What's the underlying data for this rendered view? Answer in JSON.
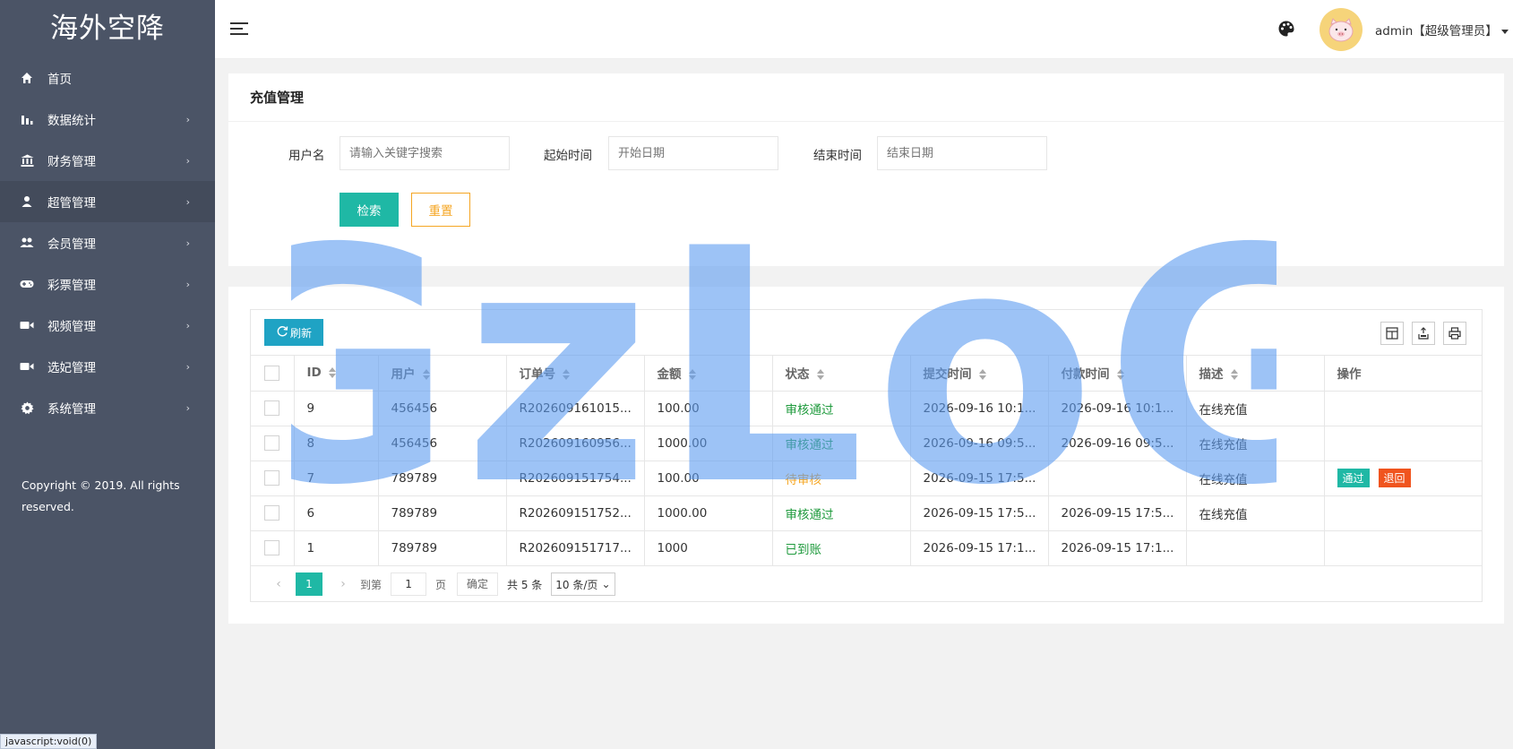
{
  "sidebar": {
    "logo": "海外空降",
    "items": [
      {
        "label": "首页",
        "icon": "home-icon",
        "has_arrow": false
      },
      {
        "label": "数据统计",
        "icon": "bar-chart-icon",
        "has_arrow": true
      },
      {
        "label": "财务管理",
        "icon": "bank-icon",
        "has_arrow": true
      },
      {
        "label": "超管管理",
        "icon": "user-icon",
        "has_arrow": true
      },
      {
        "label": "会员管理",
        "icon": "users-icon",
        "has_arrow": true
      },
      {
        "label": "彩票管理",
        "icon": "gamepad-icon",
        "has_arrow": true
      },
      {
        "label": "视频管理",
        "icon": "video-camera-icon",
        "has_arrow": true
      },
      {
        "label": "选妃管理",
        "icon": "video-camera-icon",
        "has_arrow": true
      },
      {
        "label": "系统管理",
        "icon": "gear-icon",
        "has_arrow": true
      }
    ],
    "copyright": "Copyright © 2019. All rights reserved.",
    "status_url": "javascript:void(0)"
  },
  "header": {
    "user_label": "admin【超级管理员】"
  },
  "search": {
    "title": "充值管理",
    "username_label": "用户名",
    "username_placeholder": "请输入关键字搜索",
    "start_label": "起始时间",
    "start_placeholder": "开始日期",
    "end_label": "结束时间",
    "end_placeholder": "结束日期",
    "search_btn": "检索",
    "reset_btn": "重置"
  },
  "table": {
    "refresh_label": "刷新",
    "columns": [
      "ID",
      "用户",
      "订单号",
      "金额",
      "状态",
      "提交时间",
      "付款时间",
      "描述",
      "操作"
    ],
    "rows": [
      {
        "id": "9",
        "user": "456456",
        "order": "R202609161015...",
        "amount": "100.00",
        "status": "审核通过",
        "status_type": "pass",
        "submit": "2026-09-16 10:1...",
        "paid": "2026-09-16 10:1...",
        "desc": "在线充值",
        "ops": []
      },
      {
        "id": "8",
        "user": "456456",
        "order": "R202609160956...",
        "amount": "1000.00",
        "status": "审核通过",
        "status_type": "pass",
        "submit": "2026-09-16 09:5...",
        "paid": "2026-09-16 09:5...",
        "desc": "在线充值",
        "ops": []
      },
      {
        "id": "7",
        "user": "789789",
        "order": "R202609151754...",
        "amount": "100.00",
        "status": "待审核",
        "status_type": "wait",
        "submit": "2026-09-15 17:5...",
        "paid": "",
        "desc": "在线充值",
        "ops": [
          "通过",
          "退回"
        ]
      },
      {
        "id": "6",
        "user": "789789",
        "order": "R202609151752...",
        "amount": "1000.00",
        "status": "审核通过",
        "status_type": "pass",
        "submit": "2026-09-15 17:5...",
        "paid": "2026-09-15 17:5...",
        "desc": "在线充值",
        "ops": []
      },
      {
        "id": "1",
        "user": "789789",
        "order": "R202609151717...",
        "amount": "1000",
        "status": "已到账",
        "status_type": "done",
        "submit": "2026-09-15 17:1...",
        "paid": "2026-09-15 17:1...",
        "desc": "",
        "ops": []
      }
    ]
  },
  "pager": {
    "current": "1",
    "goto_label": "到第",
    "goto_value": "1",
    "page_unit": "页",
    "confirm": "确定",
    "total": "共 5 条",
    "page_size": "10 条/页"
  },
  "watermark": "GzLoG",
  "colors": {
    "sidebar_bg": "#4b5466",
    "accent": "#1fb8a5",
    "refresh": "#1fa3c4",
    "warn": "#f5a623",
    "danger": "#f0541e",
    "watermark": "#5b9bf0"
  }
}
